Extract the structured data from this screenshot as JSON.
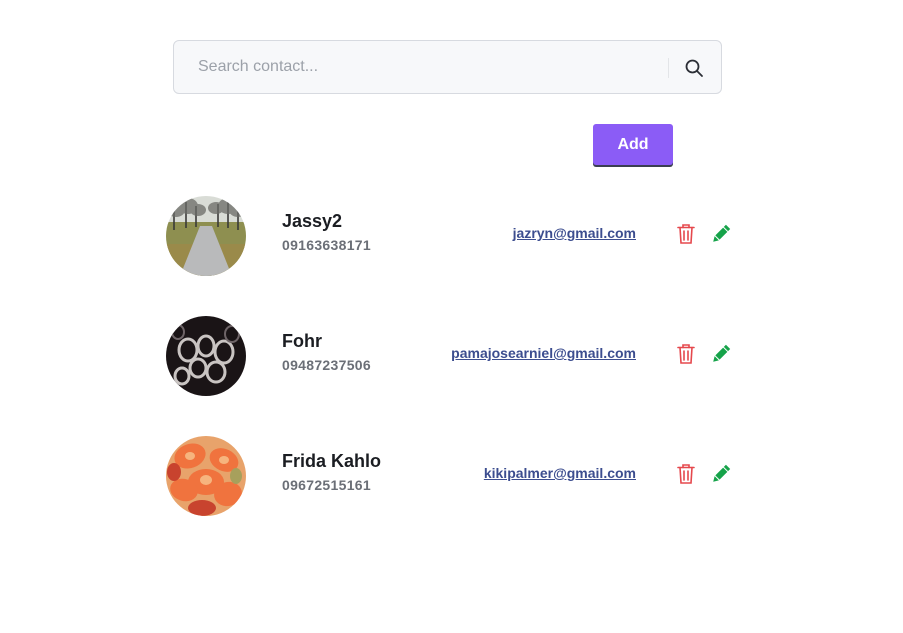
{
  "search": {
    "placeholder": "Search contact...",
    "icon": "search-icon"
  },
  "toolbar": {
    "add_label": "Add",
    "add_color": "#8b5cf6"
  },
  "contacts": [
    {
      "name": "Jassy2",
      "phone": "09163638171",
      "email": "jazryn@gmail.com",
      "avatar": "road-photo"
    },
    {
      "name": "Fohr",
      "phone": "09487237506",
      "email": "pamajosearniel@gmail.com",
      "avatar": "chains-photo"
    },
    {
      "name": "Frida Kahlo",
      "phone": "09672515161",
      "email": "kikipalmer@gmail.com",
      "avatar": "flowers-photo"
    }
  ],
  "colors": {
    "delete": "#e5484d",
    "edit": "#16a34a",
    "email": "#3c4d8f"
  }
}
